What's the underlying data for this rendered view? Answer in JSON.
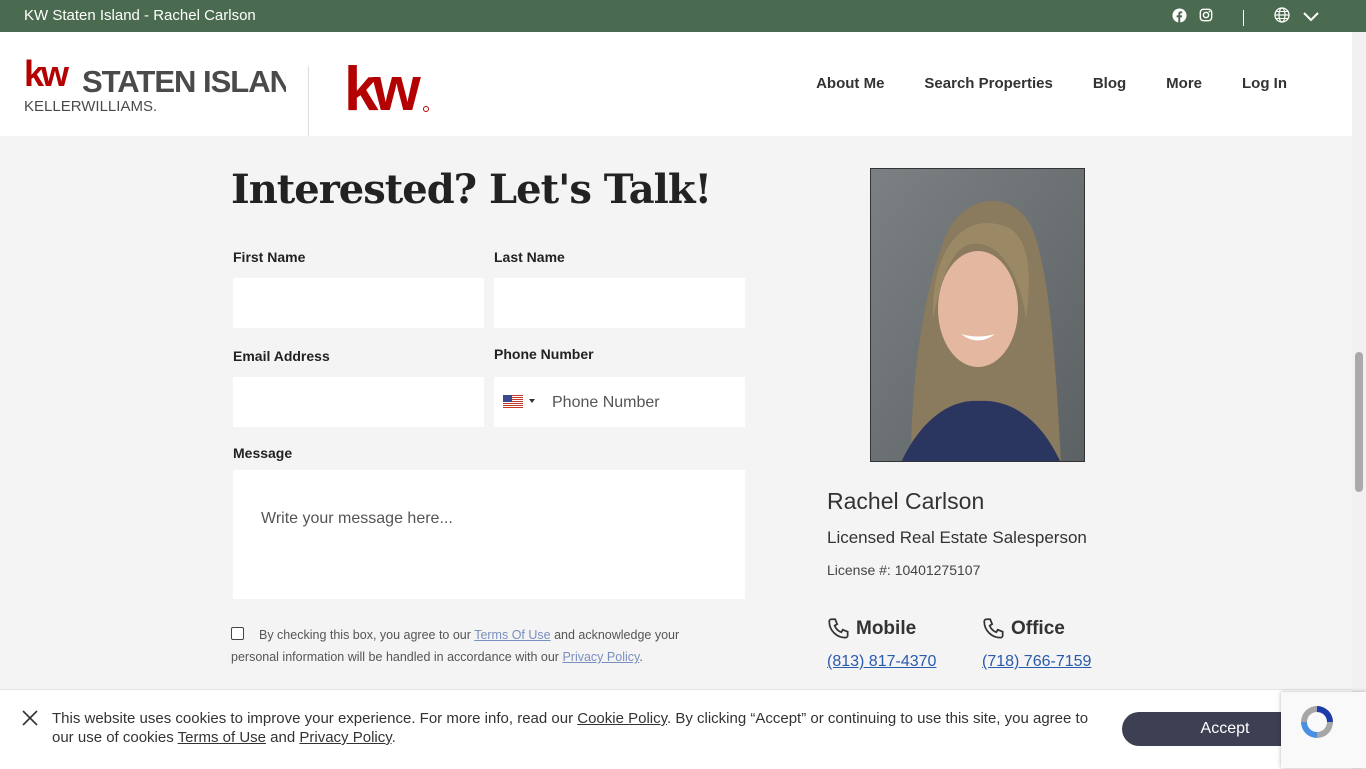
{
  "topbar": {
    "site_title": "KW Staten Island - Rachel Carlson"
  },
  "logo": {
    "line1": "STATEN ISLAND",
    "line2": "KELLERWILLIAMS."
  },
  "nav": {
    "items": [
      "About Me",
      "Search Properties",
      "Blog",
      "More",
      "Log In"
    ]
  },
  "form": {
    "title": "Interested? Let's Talk!",
    "first_name_label": "First Name",
    "last_name_label": "Last Name",
    "email_label": "Email Address",
    "phone_label": "Phone Number",
    "phone_placeholder": "Phone Number",
    "message_label": "Message",
    "message_placeholder": "Write your message here...",
    "consent_pre": "By checking this box, you agree to our ",
    "consent_terms": "Terms Of Use",
    "consent_mid": " and acknowledge your personal information will be handled in accordance with our ",
    "consent_privacy": "Privacy Policy",
    "consent_post": "."
  },
  "agent": {
    "name": "Rachel Carlson",
    "title": "Licensed Real Estate Salesperson",
    "license": "License #: 10401275107",
    "mobile_label": "Mobile",
    "mobile_phone": "(813) 817-4370",
    "office_label": "Office",
    "office_phone": "(718) 766-7159"
  },
  "cookie": {
    "text_pre": "This website uses cookies to improve your experience. For more info, read our ",
    "cookie_policy": "Cookie Policy",
    "text_mid": ". By clicking “Accept” or continuing to use this site, you agree to our use of cookies ",
    "terms": "Terms of Use",
    "and": " and ",
    "privacy": "Privacy Policy",
    "end": ".",
    "accept_label": "Accept"
  },
  "colors": {
    "topbar": "#4a6b4f",
    "brand_red": "#b40101",
    "link": "#2a5aad",
    "accept_bg": "#3d3f52"
  },
  "icons": [
    "facebook-icon",
    "instagram-icon",
    "globe-icon",
    "chevron-down-icon",
    "phone-icon",
    "close-icon",
    "us-flag-icon",
    "recaptcha-icon"
  ]
}
